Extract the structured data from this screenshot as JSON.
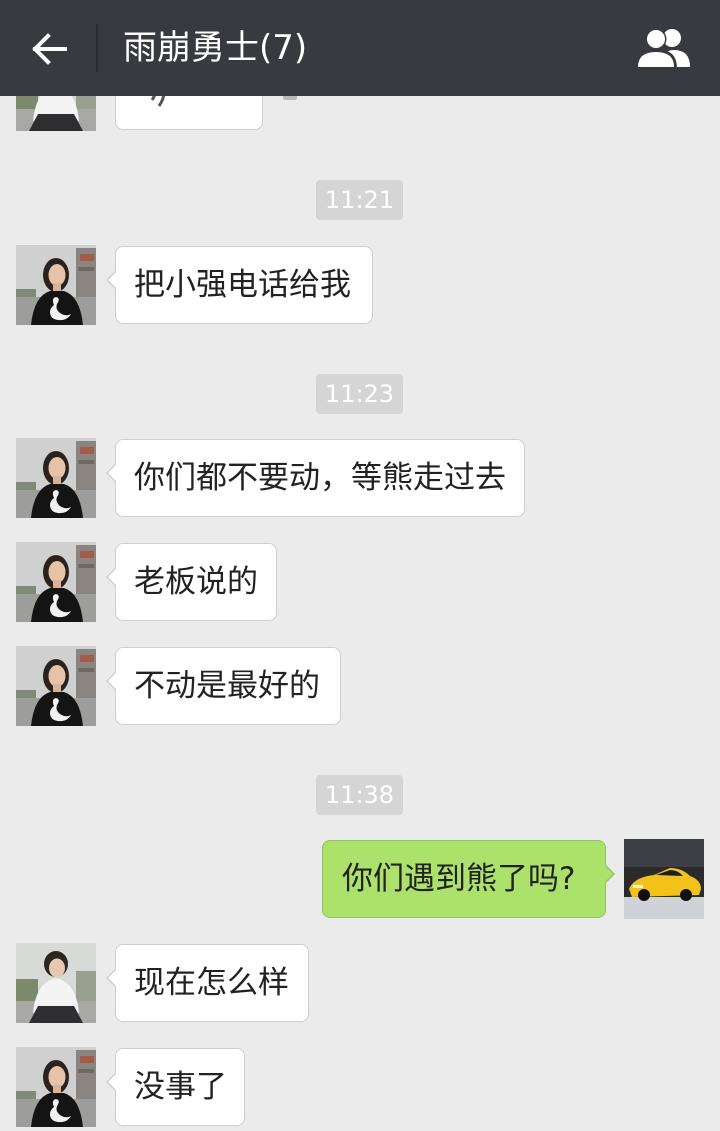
{
  "header": {
    "title": "雨崩勇士(7)",
    "back_icon": "back-arrow-icon",
    "members_icon": "group-members-icon"
  },
  "colors": {
    "header_bg": "#393a3f",
    "chat_bg": "#ebebeb",
    "incoming_bubble": "#ffffff",
    "outgoing_bubble": "#ace26c",
    "timestamp_bg": "#d5d5d5"
  },
  "messages": [
    {
      "voice_icon": "voice-wave-icon",
      "avatar_icon": "white-shirt-portrait-icon",
      "outgoing": false
    },
    {
      "time": "11:21"
    },
    {
      "text": "把小强电话给我",
      "avatar_icon": "swan-sweater-portrait-icon",
      "outgoing": false
    },
    {
      "time": "11:23"
    },
    {
      "text": "你们都不要动，等熊走过去",
      "avatar_icon": "swan-sweater-portrait-icon",
      "outgoing": false
    },
    {
      "text": "老板说的",
      "avatar_icon": "swan-sweater-portrait-icon",
      "outgoing": false
    },
    {
      "text": "不动是最好的",
      "avatar_icon": "swan-sweater-portrait-icon",
      "outgoing": false
    },
    {
      "time": "11:38"
    },
    {
      "text": "你们遇到熊了吗?",
      "avatar_icon": "yellow-sports-car-icon",
      "outgoing": true
    },
    {
      "text": "现在怎么样",
      "avatar_icon": "white-shirt-portrait-icon",
      "outgoing": false
    },
    {
      "text": "没事了",
      "avatar_icon": "swan-sweater-portrait-icon",
      "outgoing": false
    }
  ]
}
